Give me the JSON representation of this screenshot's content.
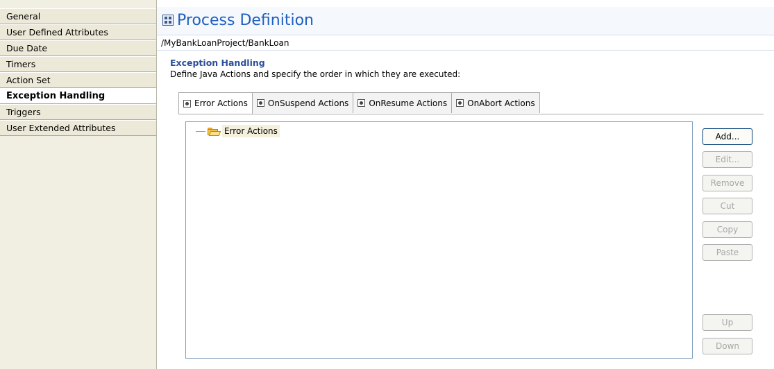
{
  "sidebar": {
    "items": [
      {
        "label": "General"
      },
      {
        "label": "User Defined Attributes"
      },
      {
        "label": "Due Date"
      },
      {
        "label": "Timers"
      },
      {
        "label": "Action Set"
      },
      {
        "label": "Exception Handling",
        "selected": true
      },
      {
        "label": "Triggers"
      },
      {
        "label": "User Extended Attributes"
      }
    ]
  },
  "header": {
    "title": "Process Definition",
    "path": "/MyBankLoanProject/BankLoan"
  },
  "section": {
    "title": "Exception Handling",
    "description": "Define Java Actions and specify the order in which they are executed:"
  },
  "tabs": [
    {
      "label": "Error Actions",
      "active": true
    },
    {
      "label": "OnSuspend Actions"
    },
    {
      "label": "OnResume Actions"
    },
    {
      "label": "OnAbort Actions"
    }
  ],
  "tree": {
    "root_label": "Error Actions",
    "root_icon": "folder-open-icon"
  },
  "buttons": {
    "add": "Add...",
    "edit": "Edit...",
    "remove": "Remove",
    "cut": "Cut",
    "copy": "Copy",
    "paste": "Paste",
    "up": "Up",
    "down": "Down"
  },
  "colors": {
    "title": "#1f5fbf",
    "section_title": "#2b4f9c",
    "sidebar_bg": "#ece9d8"
  }
}
